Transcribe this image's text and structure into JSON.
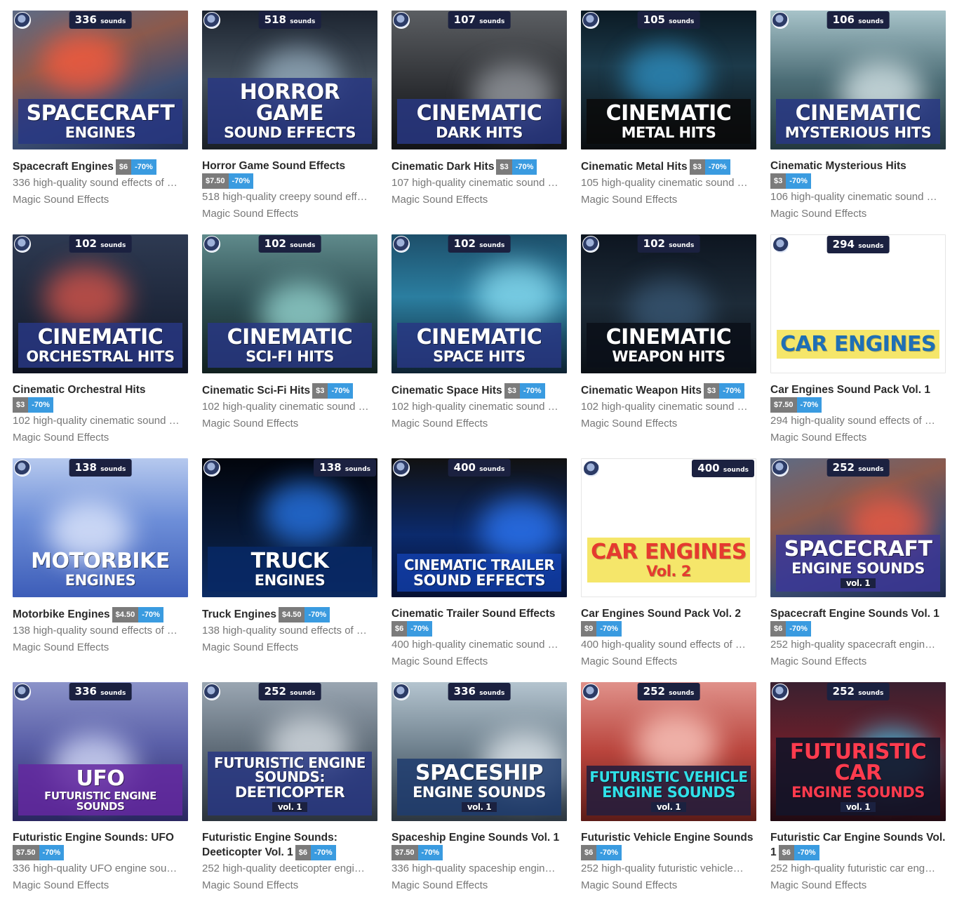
{
  "products": [
    {
      "title": "Spacecraft Engines",
      "price": "$6",
      "discount": "-70%",
      "price_inline": true,
      "description": "336 high-quality sound effects of …",
      "author": "Magic Sound Effects",
      "badge": "336",
      "badge_unit": "sounds",
      "art_line1": "SPACECRAFT",
      "art_line2": "ENGINES",
      "art_vol": "",
      "bg": "linear-gradient(160deg,#5d6b85 0%,#8b5a4d 35%,#3b4d73 65%,#1f2c4a 100%)",
      "glow": "#ff5a3c",
      "band": "rgba(40,55,130,0.85)",
      "text": "#ffffff"
    },
    {
      "title": "Horror Game Sound Effects",
      "price": "$7.50",
      "discount": "-70%",
      "price_inline": false,
      "description": "518 high-quality creepy sound eff…",
      "author": "Magic Sound Effects",
      "badge": "518",
      "badge_unit": "sounds",
      "art_line1": "HORROR GAME",
      "art_line2": "SOUND EFFECTS",
      "art_vol": "",
      "bg": "linear-gradient(180deg,#1c2430 0%,#44505c 50%,#1a1f26 100%)",
      "glow": "#9bb3c4",
      "band": "rgba(40,55,130,0.85)",
      "text": "#ffffff"
    },
    {
      "title": "Cinematic Dark Hits",
      "price": "$3",
      "discount": "-70%",
      "price_inline": true,
      "description": "107 high-quality cinematic sound …",
      "author": "Magic Sound Effects",
      "badge": "107",
      "badge_unit": "sounds",
      "art_line1": "CINEMATIC",
      "art_line2": "DARK HITS",
      "art_vol": "",
      "bg": "linear-gradient(180deg,#5b5e62 0%,#2a2c30 60%,#121316 100%)",
      "glow": "#a0a4aa",
      "band": "rgba(40,55,130,0.85)",
      "text": "#ffffff"
    },
    {
      "title": "Cinematic Metal Hits",
      "price": "$3",
      "discount": "-70%",
      "price_inline": true,
      "description": "105 high-quality cinematic sound …",
      "author": "Magic Sound Effects",
      "badge": "105",
      "badge_unit": "sounds",
      "art_line1": "CINEMATIC",
      "art_line2": "METAL HITS",
      "art_vol": "",
      "bg": "linear-gradient(180deg,#0b1a24 0%,#1c3a4a 40%,#0a0d10 100%)",
      "glow": "#2f93c7",
      "band": "rgba(10,10,10,0.85)",
      "text": "#ffffff"
    },
    {
      "title": "Cinematic Mysterious Hits",
      "price": "$3",
      "discount": "-70%",
      "price_inline": false,
      "description": "106 high-quality cinematic sound …",
      "author": "Magic Sound Effects",
      "badge": "106",
      "badge_unit": "sounds",
      "art_line1": "CINEMATIC",
      "art_line2": "MYSTERIOUS HITS",
      "art_vol": "",
      "bg": "linear-gradient(180deg,#a7c3c9 0%,#4c6d76 50%,#23383f 100%)",
      "glow": "#e3f0f2",
      "band": "rgba(40,55,130,0.85)",
      "text": "#ffffff"
    },
    {
      "title": "Cinematic Orchestral Hits",
      "price": "$3",
      "discount": "-70%",
      "price_inline": false,
      "description": "102 high-quality cinematic sound …",
      "author": "Magic Sound Effects",
      "badge": "102",
      "badge_unit": "sounds",
      "art_line1": "CINEMATIC",
      "art_line2": "ORCHESTRAL HITS",
      "art_vol": "",
      "bg": "linear-gradient(180deg,#2e3a52 0%,#1c2538 60%,#0d1220 100%)",
      "glow": "#e2574a",
      "band": "rgba(40,55,130,0.85)",
      "text": "#ffffff"
    },
    {
      "title": "Cinematic Sci-Fi Hits",
      "price": "$3",
      "discount": "-70%",
      "price_inline": true,
      "description": "102 high-quality cinematic sound …",
      "author": "Magic Sound Effects",
      "badge": "102",
      "badge_unit": "sounds",
      "art_line1": "CINEMATIC",
      "art_line2": "SCI-FI HITS",
      "art_vol": "",
      "bg": "linear-gradient(180deg,#5f8a8b 0%,#2d4d52 50%,#11201f 100%)",
      "glow": "#9de0da",
      "band": "rgba(40,55,130,0.85)",
      "text": "#ffffff"
    },
    {
      "title": "Cinematic Space Hits",
      "price": "$3",
      "discount": "-70%",
      "price_inline": true,
      "description": "102 high-quality cinematic sound …",
      "author": "Magic Sound Effects",
      "badge": "102",
      "badge_unit": "sounds",
      "art_line1": "CINEMATIC",
      "art_line2": "SPACE HITS",
      "art_vol": "",
      "bg": "linear-gradient(180deg,#1d4f6a 0%,#2b7ea0 45%,#0e2232 100%)",
      "glow": "#8ee3f7",
      "band": "rgba(40,55,130,0.85)",
      "text": "#ffffff"
    },
    {
      "title": "Cinematic Weapon Hits",
      "price": "$3",
      "discount": "-70%",
      "price_inline": true,
      "description": "102 high-quality cinematic sound …",
      "author": "Magic Sound Effects",
      "badge": "102",
      "badge_unit": "sounds",
      "art_line1": "CINEMATIC",
      "art_line2": "WEAPON HITS",
      "art_vol": "",
      "bg": "linear-gradient(180deg,#0d1520 0%,#1d2b38 50%,#0a0f15 100%)",
      "glow": "#3a5a78",
      "band": "rgba(10,15,25,0.85)",
      "text": "#ffffff"
    },
    {
      "title": "Car Engines Sound Pack Vol. 1",
      "price": "$7.50",
      "discount": "-70%",
      "price_inline": false,
      "description": "294 high-quality sound effects of …",
      "author": "Magic Sound Effects",
      "badge": "294",
      "badge_unit": "sounds",
      "art_line1": "CAR ENGINES",
      "art_line2": "",
      "art_vol": "",
      "bg": "linear-gradient(180deg,#ffffff 0%,#ffffff 100%)",
      "glow": "#ffffff",
      "band": "#f5e66a",
      "text": "#1f6fb5"
    },
    {
      "title": "Motorbike Engines",
      "price": "$4.50",
      "discount": "-70%",
      "price_inline": true,
      "description": "138 high-quality sound effects of …",
      "author": "Magic Sound Effects",
      "badge": "138",
      "badge_unit": "sounds",
      "art_line1": "MOTORBIKE",
      "art_line2": "ENGINES",
      "art_vol": "",
      "bg": "linear-gradient(180deg,#b6c9ee 0%,#6d8ed8 45%,#3d5db8 100%)",
      "glow": "#eaf0ff",
      "band": "rgba(0,0,0,0)",
      "text": "#ffffff"
    },
    {
      "title": "Truck Engines",
      "price": "$4.50",
      "discount": "-70%",
      "price_inline": true,
      "description": "138 high-quality sound effects of …",
      "author": "Magic Sound Effects",
      "badge": "138",
      "badge_unit": "sounds",
      "art_line1": "TRUCK",
      "art_line2": "ENGINES",
      "art_vol": "",
      "bg": "linear-gradient(180deg,#02050c 0%,#081a3a 60%,#0c2c64 100%)",
      "glow": "#2a7df5",
      "band": "rgba(8,40,100,0.9)",
      "text": "#ffffff"
    },
    {
      "title": "Cinematic Trailer Sound Effects",
      "price": "$6",
      "discount": "-70%",
      "price_inline": false,
      "description": "400 high-quality cinematic sound …",
      "author": "Magic Sound Effects",
      "badge": "400",
      "badge_unit": "sounds",
      "art_line1": "CINEMATIC TRAILER",
      "art_line2": "SOUND EFFECTS",
      "art_vol": "",
      "bg": "linear-gradient(180deg,#111 0%,#0b2a6c 55%,#051030 100%)",
      "glow": "#2f7cff",
      "band": "rgba(20,70,190,0.7)",
      "text": "#ffffff"
    },
    {
      "title": "Car Engines Sound Pack Vol. 2",
      "price": "$9",
      "discount": "-70%",
      "price_inline": false,
      "description": "400 high-quality sound effects of …",
      "author": "Magic Sound Effects",
      "badge": "400",
      "badge_unit": "sounds",
      "art_line1": "CAR ENGINES",
      "art_line2": "Vol. 2",
      "art_vol": "",
      "bg": "linear-gradient(180deg,#ffffff 0%,#ffffff 100%)",
      "glow": "#ffffff",
      "band": "#f5e66a",
      "text": "#e53a2f"
    },
    {
      "title": "Spacecraft Engine Sounds Vol. 1",
      "price": "$6",
      "discount": "-70%",
      "price_inline": false,
      "description": "252 high-quality spacecraft engin…",
      "author": "Magic Sound Effects",
      "badge": "252",
      "badge_unit": "sounds",
      "art_line1": "SPACECRAFT",
      "art_line2": "ENGINE SOUNDS",
      "art_vol": "vol. 1",
      "bg": "linear-gradient(160deg,#5d6b85 0%,#8b5a4d 35%,#3b4d73 65%,#1f2c4a 100%)",
      "glow": "#ff5a3c",
      "band": "rgba(60,55,150,0.85)",
      "text": "#ffffff"
    },
    {
      "title": "Futuristic Engine Sounds: UFO",
      "price": "$7.50",
      "discount": "-70%",
      "price_inline": false,
      "description": "336 high-quality UFO engine sou…",
      "author": "Magic Sound Effects",
      "badge": "336",
      "badge_unit": "sounds",
      "art_line1": "UFO",
      "art_line2": "FUTURISTIC ENGINE SOUNDS",
      "art_vol": "",
      "bg": "linear-gradient(180deg,#8b93c9 0%,#5a5fa8 45%,#2a2660 100%)",
      "glow": "#dfe6ff",
      "band": "rgba(100,40,160,0.85)",
      "text": "#ffffff"
    },
    {
      "title": "Futuristic Engine Sounds: Deeticopter Vol. 1",
      "price": "$6",
      "discount": "-70%",
      "price_inline": true,
      "description": "252 high-quality deeticopter engi…",
      "author": "Magic Sound Effects",
      "badge": "252",
      "badge_unit": "sounds",
      "art_line1": "FUTURISTIC ENGINE SOUNDS:",
      "art_line2": "DEETICOPTER",
      "art_vol": "vol. 1",
      "bg": "linear-gradient(180deg,#9aa6b2 0%,#5d6a76 50%,#2b333c 100%)",
      "glow": "#dfe5ea",
      "band": "rgba(40,55,130,0.85)",
      "text": "#ffffff"
    },
    {
      "title": "Spaceship Engine Sounds Vol. 1",
      "price": "$7.50",
      "discount": "-70%",
      "price_inline": false,
      "description": "336 high-quality spaceship engin…",
      "author": "Magic Sound Effects",
      "badge": "336",
      "badge_unit": "sounds",
      "art_line1": "SPACESHIP",
      "art_line2": "ENGINE SOUNDS",
      "art_vol": "vol. 1",
      "bg": "linear-gradient(180deg,#b4c4cf 0%,#6c7e8b 50%,#2c3640 100%)",
      "glow": "#eef4f8",
      "band": "rgba(30,60,110,0.85)",
      "text": "#ffffff"
    },
    {
      "title": "Futuristic Vehicle Engine Sounds",
      "price": "$6",
      "discount": "-70%",
      "price_inline": false,
      "description": "252 high-quality futuristic vehicle…",
      "author": "Magic Sound Effects",
      "badge": "252",
      "badge_unit": "sounds",
      "art_line1": "FUTURISTIC VEHICLE",
      "art_line2": "ENGINE SOUNDS",
      "art_vol": "vol. 1",
      "bg": "linear-gradient(180deg,#e0918a 0%,#b9443c 50%,#5c1c18 100%)",
      "glow": "#ffd1c8",
      "band": "rgba(40,30,60,0.9)",
      "text": "#2fe0e8"
    },
    {
      "title": "Futuristic Car Engine Sounds Vol. 1",
      "price": "$6",
      "discount": "-70%",
      "price_inline": true,
      "description": "252 high-quality futuristic car eng…",
      "author": "Magic Sound Effects",
      "badge": "252",
      "badge_unit": "sounds",
      "art_line1": "FUTURISTIC CAR",
      "art_line2": "ENGINE SOUNDS",
      "art_vol": "vol. 1",
      "bg": "linear-gradient(180deg,#3a2030 0%,#6a1f2a 45%,#200a12 100%)",
      "glow": "#3bd5ff",
      "band": "rgba(20,20,40,0.9)",
      "text": "#ff3b4e"
    }
  ]
}
